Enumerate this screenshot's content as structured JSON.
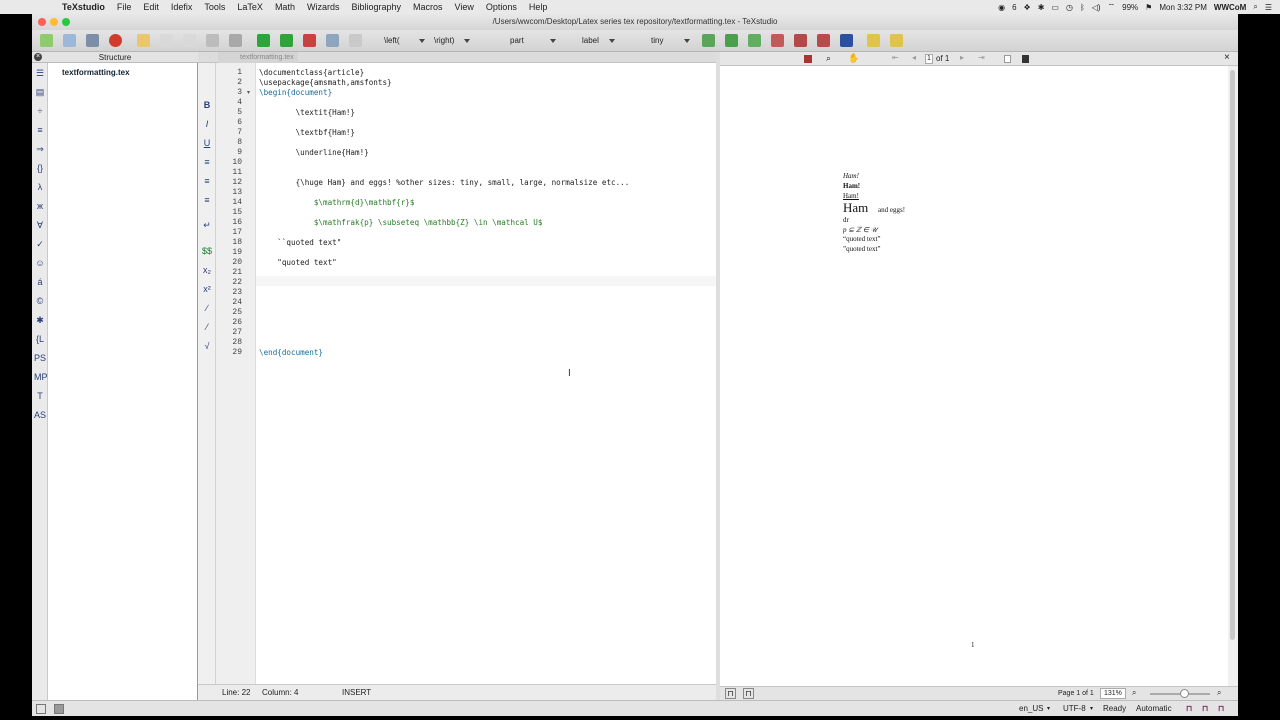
{
  "menubar": {
    "app_name": "TeXstudio",
    "items": [
      "File",
      "Edit",
      "Idefix",
      "Tools",
      "LaTeX",
      "Math",
      "Wizards",
      "Bibliography",
      "Macros",
      "View",
      "Options",
      "Help"
    ],
    "status_badge_count": "6",
    "battery": "99%",
    "clock": "Mon 3:32 PM",
    "user": "WWCoM"
  },
  "window": {
    "title": "/Users/wwcom/Desktop/Latex series tex repository/textformatting.tex - TeXstudio"
  },
  "toolbar": {
    "left_delim": "\\left(",
    "right_delim": "\\right)",
    "sectioning": "part",
    "reference": "label",
    "size": "tiny"
  },
  "structure": {
    "header": "Structure",
    "file": "textformatting.tex"
  },
  "editor": {
    "tab_label": "textformatting.tex",
    "line_numbers": [
      "1",
      "2",
      "3",
      "4",
      "5",
      "6",
      "7",
      "8",
      "9",
      "10",
      "11",
      "12",
      "13",
      "14",
      "15",
      "16",
      "17",
      "18",
      "19",
      "20",
      "21",
      "22",
      "23",
      "24",
      "25",
      "26",
      "27",
      "28",
      "29"
    ],
    "lines": [
      "\\documentclass{article}",
      "\\usepackage{amsmath,amsfonts}",
      "\\begin{document}",
      "",
      "        \\textit{Ham!}",
      "",
      "        \\textbf{Ham!}",
      "",
      "        \\underline{Ham!}",
      "",
      "",
      "        {\\huge Ham} and eggs! %other sizes: tiny, small, large, normalsize etc...",
      "",
      "            $\\mathrm{d}\\mathbf{r}$",
      "",
      "            $\\mathfrak{p} \\subseteq \\mathbb{Z} \\in \\mathcal U$",
      "",
      "    ``quoted text\"",
      "",
      "    \"quoted text\"",
      "",
      "",
      "",
      "",
      "",
      "",
      "",
      "",
      "\\end{document}"
    ],
    "status": {
      "line": "Line: 22",
      "column": "Column: 4",
      "mode": "INSERT"
    }
  },
  "pdf": {
    "page_input": "1",
    "page_total": "of 1",
    "preview": {
      "italic": "Ham!",
      "bold": "Ham!",
      "underline": "Ham!",
      "huge_word": "Ham",
      "rest": "and eggs!",
      "dr": "dr",
      "math_line": "p ⊆ ℤ ∈ 𝒰",
      "quote1": "“quoted text”",
      "quote2": "”quoted text”",
      "page_number": "1"
    },
    "page_label": "Page 1 of 1",
    "zoom": "131%"
  },
  "bottom": {
    "language": "en_US",
    "encoding": "UTF-8",
    "ready": "Ready",
    "mode": "Automatic"
  }
}
